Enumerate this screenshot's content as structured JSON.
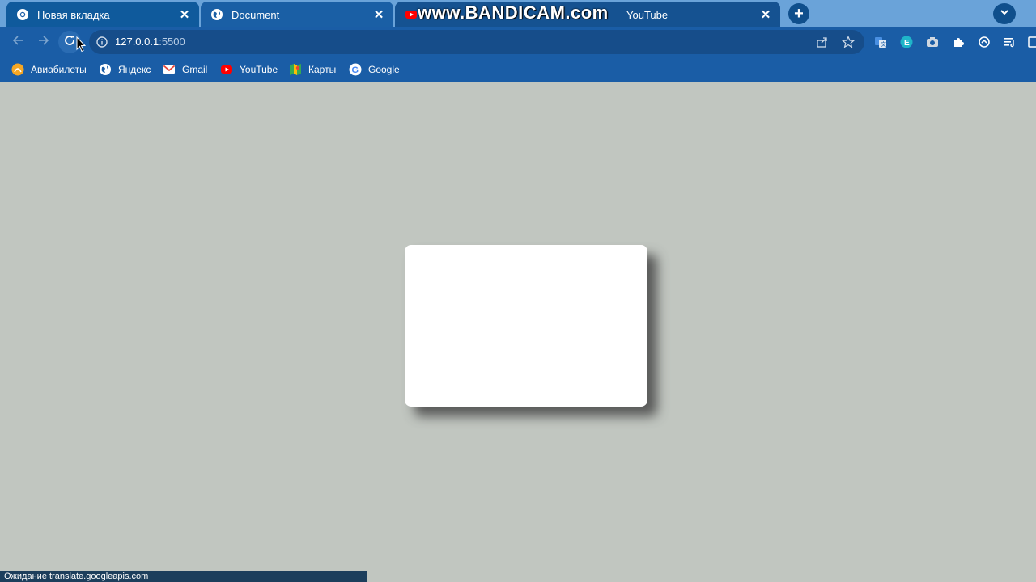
{
  "tabs": [
    {
      "title": "Новая вкладка",
      "icon": "chrome-icon"
    },
    {
      "title": "Document",
      "icon": "globe-icon"
    },
    {
      "title": "YouTube",
      "icon": "youtube-icon"
    }
  ],
  "watermark": "www.BANDICAM.com",
  "address_bar": {
    "host": "127.0.0.1",
    "port": ":5500"
  },
  "bookmarks": [
    {
      "label": "Авиабилеты",
      "icon": "aviasales-icon"
    },
    {
      "label": "Яндекс",
      "icon": "globe-icon"
    },
    {
      "label": "Gmail",
      "icon": "gmail-icon"
    },
    {
      "label": "YouTube",
      "icon": "youtube-icon"
    },
    {
      "label": "Карты",
      "icon": "maps-icon"
    },
    {
      "label": "Google",
      "icon": "google-icon"
    }
  ],
  "status_text": "Ожидание translate.googleapis.com",
  "colors": {
    "tab_strip": "#6aa3d9",
    "toolbar": "#1a5da6",
    "page_background": "#c1c6c0",
    "card": "#ffffff"
  }
}
